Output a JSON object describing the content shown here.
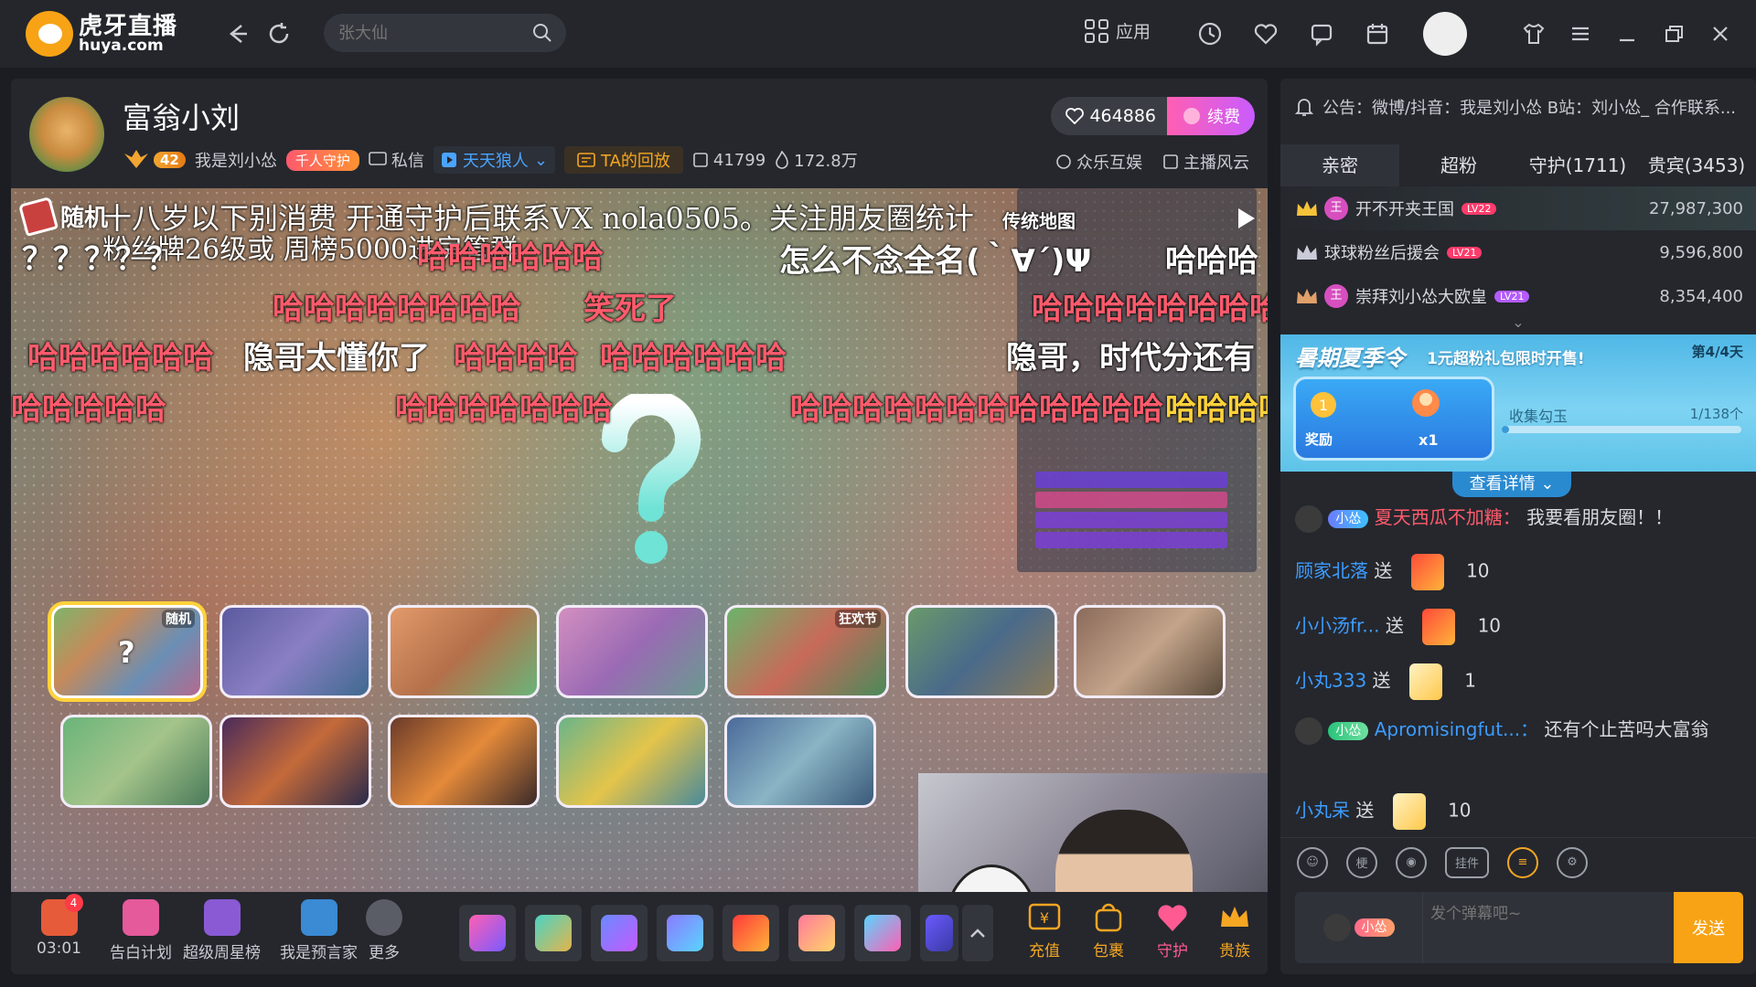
{
  "topbar": {
    "logo_cn": "虎牙直播",
    "logo_en": "huya.com",
    "search_placeholder": "张大仙",
    "apps_label": "应用"
  },
  "streamer": {
    "name": "富翁小刘",
    "level": "42",
    "nickname_short": "我是刘小怂",
    "guard_badge": "千人守护",
    "message_label": "私信",
    "game_label": "天天狼人",
    "replay_label": "TA的回放",
    "room_id": "41799",
    "heat": "172.8万",
    "subscribers": "464886",
    "subscribe_label": "续费",
    "link_entertain": "众乐互娱",
    "link_anchor": "主播风云"
  },
  "video": {
    "random_label": "随机",
    "danmaku": [
      {
        "text": "十八岁以下别消费  开通守护后联系VX  nola0505。关注朋友圈统计",
        "style": "s"
      },
      {
        "text": "粉丝牌26级或  周榜5000进房管群",
        "style": "s"
      },
      {
        "text": "？？？？？",
        "style": "w"
      },
      {
        "text": "哈哈哈哈哈哈",
        "style": "r"
      },
      {
        "text": "怎么不念全名(｀∀´)Ψ",
        "style": "w"
      },
      {
        "text": "哈哈哈",
        "style": "w"
      },
      {
        "text": "哈哈哈哈哈哈哈哈",
        "style": "r"
      },
      {
        "text": "笑死了",
        "style": "r"
      },
      {
        "text": "哈哈哈哈哈哈哈哈哈",
        "style": "r"
      },
      {
        "text": "哈哈哈哈哈哈",
        "style": "r"
      },
      {
        "text": "隐哥太懂你了",
        "style": "w"
      },
      {
        "text": "哈哈哈哈",
        "style": "r"
      },
      {
        "text": "哈哈哈哈哈哈",
        "style": "r"
      },
      {
        "text": "隐哥，时代分还有",
        "style": "w"
      },
      {
        "text": "哈哈哈哈哈",
        "style": "r"
      },
      {
        "text": "哈哈哈哈哈哈哈",
        "style": "r"
      },
      {
        "text": "哈哈哈哈哈哈哈哈哈哈哈哈",
        "style": "r"
      },
      {
        "text": "哈哈哈哈",
        "style": "r"
      },
      {
        "text": "传统地图",
        "style": "w"
      }
    ],
    "map_tags": {
      "random": "随机",
      "carnival": "狂欢节"
    }
  },
  "bottombar": {
    "timer": "03:01",
    "timer_badge": "4",
    "items": [
      "告白计划",
      "超级周星榜",
      "我是预言家",
      "更多"
    ],
    "right": [
      "充值",
      "包裹",
      "守护",
      "贵族"
    ]
  },
  "side": {
    "notice": "公告：微博/抖音：我是刘小怂 B站：刘小怂_ 合作联系...",
    "tabs": [
      "亲密",
      "超粉",
      "守护(1711)",
      "贵宾(3453)"
    ],
    "ranks": [
      {
        "name": "开不开夹王国",
        "lv": "LV22",
        "score": "27,987,300"
      },
      {
        "name": "球球粉丝后援会",
        "lv": "LV21",
        "score": "9,596,800"
      },
      {
        "name": "崇拜刘小怂大欧皇",
        "lv": "LV21",
        "score": "8,354,400"
      }
    ],
    "banner": {
      "title": "暑期夏季令",
      "subtitle": "1元超粉礼包限时开售!",
      "stage": "第4/4天",
      "reward_label": "奖励",
      "reward_count": "x1",
      "collect_label": "收集勾玉",
      "progress_text": "1/138个",
      "progress": 0.0072
    },
    "details_label": "查看详情",
    "chat": {
      "m1_badge": "小怂",
      "m1_nick": "夏天西瓜不加糖：",
      "m1_text": "我要看朋友圈！！",
      "m2_nick": "顾家北落",
      "m2_send": "送",
      "m2_count": "10",
      "m3_nick": "小小汤fr...",
      "m3_send": "送",
      "m3_count": "10",
      "m4_nick": "小丸333",
      "m4_send": "送",
      "m4_count": "1",
      "m5_badge": "小怂",
      "m5_nick": "Apromisingfut...：",
      "m5_text": "还有个止苦吗大富翁",
      "m6_nick": "小丸呆",
      "m6_send": "送",
      "m6_count": "10"
    },
    "tools": [
      "梗",
      "挂件"
    ],
    "input_badge": "小怂",
    "input_placeholder": "发个弹幕吧~",
    "send_label": "发送"
  }
}
